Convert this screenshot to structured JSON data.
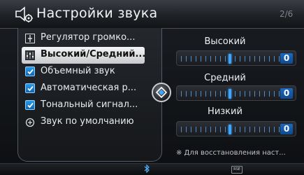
{
  "header": {
    "title": "Настройки звука",
    "page": "2/6"
  },
  "menu": {
    "items": [
      {
        "label": "Регулятор громко...",
        "icon": "volume-slider-icon",
        "selected": false
      },
      {
        "label": "Высокий/Средний...",
        "icon": "equalizer-icon",
        "selected": true
      },
      {
        "label": "Объемный звук",
        "icon": "checkbox-checked-icon",
        "selected": false
      },
      {
        "label": "Автоматическая р...",
        "icon": "checkbox-checked-icon",
        "selected": false
      },
      {
        "label": "Тональный сигнал...",
        "icon": "checkbox-checked-icon",
        "selected": false
      },
      {
        "label": "Звук по умолчанию",
        "icon": "reset-sound-icon",
        "selected": false
      }
    ]
  },
  "sliders": {
    "high": {
      "label": "Высокий",
      "value": "0",
      "level": 0.5
    },
    "mid": {
      "label": "Средний",
      "value": "0",
      "level": 0.5
    },
    "low": {
      "label": "Низкий",
      "value": "0",
      "level": 0.5
    }
  },
  "note": "※ Для восстановления наст...",
  "status": {
    "bluetooth_icon": "bluetooth-icon",
    "rss_label": "RSE"
  },
  "colors": {
    "accent": "#3ea6ff",
    "value_box": "#1c6ac0",
    "selected_bg": "#e8eaec"
  }
}
